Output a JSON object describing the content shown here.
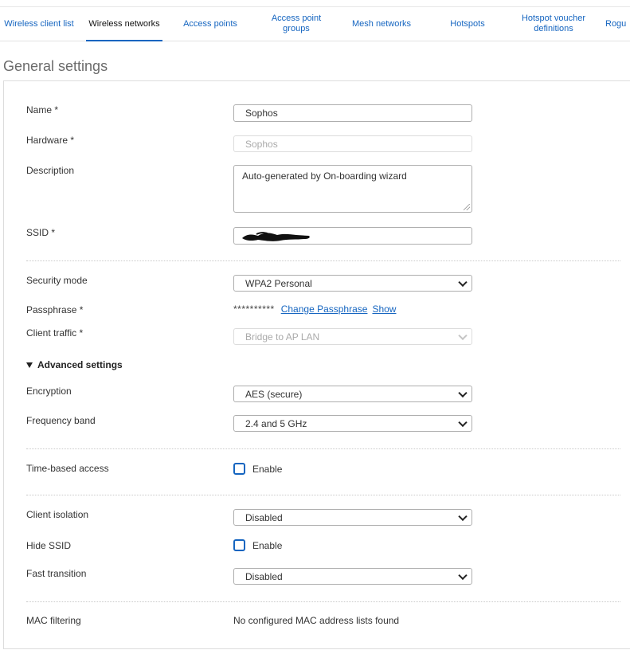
{
  "tabs": [
    {
      "label": "Wireless client list",
      "active": false
    },
    {
      "label": "Wireless networks",
      "active": true
    },
    {
      "label": "Access points",
      "active": false
    },
    {
      "label": "Access point\ngroups",
      "active": false
    },
    {
      "label": "Mesh networks",
      "active": false
    },
    {
      "label": "Hotspots",
      "active": false
    },
    {
      "label": "Hotspot voucher\ndefinitions",
      "active": false
    },
    {
      "label": "Rogu",
      "active": false
    }
  ],
  "section_title": "General settings",
  "form": {
    "name": {
      "label": "Name *",
      "value": "Sophos"
    },
    "hardware": {
      "label": "Hardware *",
      "value": "Sophos"
    },
    "description": {
      "label": "Description",
      "value": "Auto-generated by On-boarding wizard"
    },
    "ssid": {
      "label": "SSID *",
      "value": ""
    },
    "security_mode": {
      "label": "Security mode",
      "value": "WPA2 Personal"
    },
    "passphrase": {
      "label": "Passphrase *",
      "masked": "**********",
      "change_link": "Change Passphrase",
      "show_link": "Show"
    },
    "client_traffic": {
      "label": "Client traffic *",
      "value": "Bridge to AP LAN"
    },
    "advanced_toggle": "Advanced settings",
    "encryption": {
      "label": "Encryption",
      "value": "AES (secure)"
    },
    "frequency_band": {
      "label": "Frequency band",
      "value": "2.4 and 5 GHz"
    },
    "time_based_access": {
      "label": "Time-based access",
      "checkbox_label": "Enable",
      "checked": false
    },
    "client_isolation": {
      "label": "Client isolation",
      "value": "Disabled"
    },
    "hide_ssid": {
      "label": "Hide SSID",
      "checkbox_label": "Enable",
      "checked": false
    },
    "fast_transition": {
      "label": "Fast transition",
      "value": "Disabled"
    },
    "mac_filtering": {
      "label": "MAC filtering",
      "value": "No configured MAC address lists found"
    }
  },
  "colors": {
    "accent": "#1565c0",
    "text": "#333333",
    "border": "#aeaeae"
  }
}
